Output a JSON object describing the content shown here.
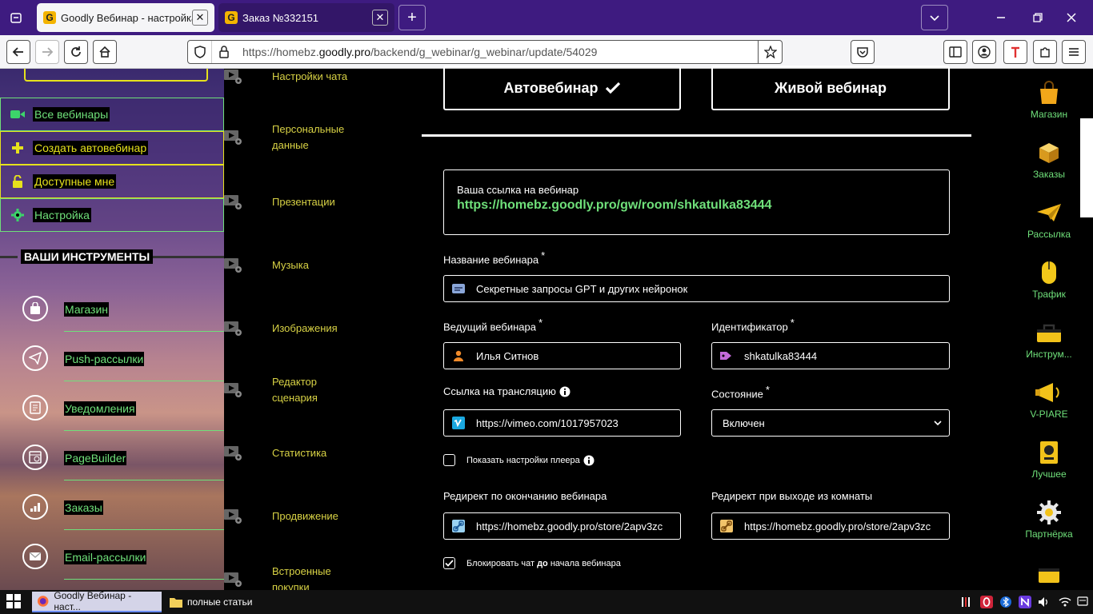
{
  "browser": {
    "tabs": [
      {
        "title": "Goodly Вебинар - настройка",
        "favicon": "G"
      },
      {
        "title": "Заказ №332151",
        "favicon": "G"
      }
    ],
    "url": {
      "prefix": "https://homebz.",
      "domain": "goodly.pro",
      "path": "/backend/g_webinar/g_webinar/update/54029"
    },
    "new_tab": "+",
    "close_tab": "✕"
  },
  "sidebar": {
    "menu": [
      {
        "label": "Все вебинары",
        "icon": "video-icon"
      },
      {
        "label": "Создать автовебинар",
        "icon": "plus-icon"
      },
      {
        "label": "Доступные мне",
        "icon": "unlock-icon"
      },
      {
        "label": "Настройка",
        "icon": "gear-icon"
      }
    ],
    "tools_heading": "ВАШИ ИНСТРУМЕНТЫ",
    "tools": [
      {
        "label": "Магазин",
        "icon": "bag-icon"
      },
      {
        "label": "Push-рассылки",
        "icon": "paper-plane-icon"
      },
      {
        "label": "Уведомления",
        "icon": "document-icon"
      },
      {
        "label": "PageBuilder",
        "icon": "page-builder-icon"
      },
      {
        "label": "Заказы",
        "icon": "chart-icon"
      },
      {
        "label": "Email-рассылки",
        "icon": "envelope-icon"
      }
    ]
  },
  "sections": [
    {
      "label": "Настройки чата"
    },
    {
      "label": "Персональные данные"
    },
    {
      "label": "Презентации"
    },
    {
      "label": "Музыка"
    },
    {
      "label": "Изображения"
    },
    {
      "label": "Редактор сценария"
    },
    {
      "label": "Статистика"
    },
    {
      "label": "Продвижение"
    },
    {
      "label": "Встроенные покупки"
    }
  ],
  "form": {
    "mode_auto": "Автовебинар",
    "mode_live": "Живой вебинар",
    "link_caption": "Ваша ссылка на вебинар",
    "link_url": "https://homebz.goodly.pro/gw/room/shkatulka83444",
    "name_label": "Название вебинара",
    "required_mark": "*",
    "name_value": "Секретные запросы GPT и других нейронок",
    "host_label": "Ведущий вебинара",
    "host_value": "Илья Ситнов",
    "id_label": "Идентификатор",
    "id_value": "shkatulka83444",
    "stream_label": "Ссылка на трансляцию",
    "stream_value": "https://vimeo.com/1017957023",
    "state_label": "Состояние",
    "state_value": "Включен",
    "player_settings_label": "Показать настройки плеера",
    "redirect_end_label": "Редирект по окончанию вебинара",
    "redirect_end_value": "https://homebz.goodly.pro/store/2apv3zc",
    "redirect_exit_label": "Редирект при выходе из комнаты",
    "redirect_exit_value": "https://homebz.goodly.pro/store/2apv3zc",
    "block_chat_label_pre": "Блокировать чат ",
    "block_chat_label_bold": "до",
    "block_chat_label_post": " начала вебинара"
  },
  "rightbar": [
    {
      "label": "Магазин"
    },
    {
      "label": "Заказы"
    },
    {
      "label": "Рассылка"
    },
    {
      "label": "Трафик"
    },
    {
      "label": "Инструм..."
    },
    {
      "label": "V-PIARE"
    },
    {
      "label": "Лучшее"
    },
    {
      "label": "Партнёрка"
    }
  ],
  "taskbar": {
    "apps": [
      {
        "label": "Goodly Вебинар - наст..."
      },
      {
        "label": "полные статьи"
      }
    ]
  },
  "colors": {
    "accent_green": "#6fe07a",
    "accent_yellow": "#e6e21c",
    "section_text": "#d8d245",
    "tab_bar": "#3e1b80"
  }
}
